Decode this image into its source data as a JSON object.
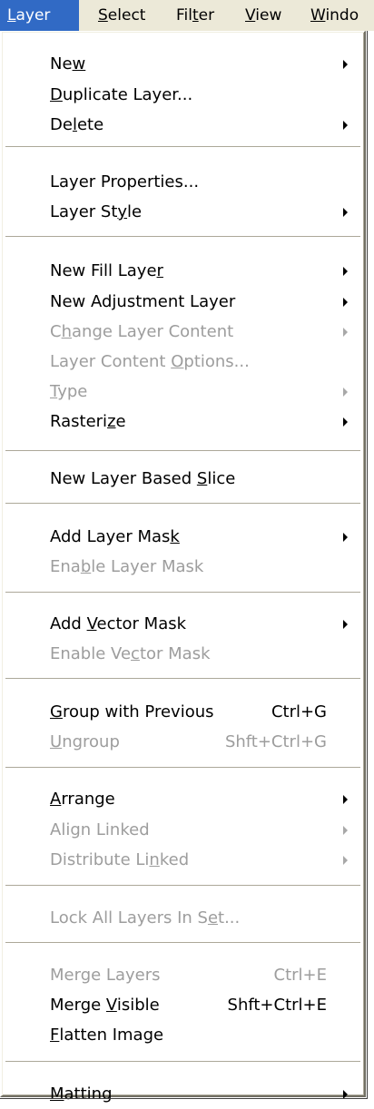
{
  "menubar": {
    "items": [
      {
        "label": "Layer",
        "ul": "L",
        "rest": "ayer"
      },
      {
        "label": "Select",
        "ul": "S",
        "rest": "elect"
      },
      {
        "label": "Filter",
        "pre": "Fil",
        "ul": "t",
        "rest": "er"
      },
      {
        "label": "View",
        "ul": "V",
        "rest": "iew"
      },
      {
        "label": "Window",
        "ul": "W",
        "rest": "indo"
      }
    ]
  },
  "menu": {
    "items": [
      {
        "label": "New",
        "pre": "Ne",
        "ul": "w",
        "rest": "",
        "shortcut": "",
        "submenu": true,
        "disabled": false
      },
      {
        "label": "Duplicate Layer...",
        "pre": "",
        "ul": "D",
        "rest": "uplicate Layer...",
        "shortcut": "",
        "submenu": false,
        "disabled": false
      },
      {
        "label": "Delete",
        "pre": "De",
        "ul": "l",
        "rest": "ete",
        "shortcut": "",
        "submenu": true,
        "disabled": false
      },
      {
        "label": "Layer Properties...",
        "pre": "Layer Properties...",
        "ul": "",
        "rest": "",
        "shortcut": "",
        "submenu": false,
        "disabled": false
      },
      {
        "label": "Layer Style",
        "pre": "Layer St",
        "ul": "y",
        "rest": "le",
        "shortcut": "",
        "submenu": true,
        "disabled": false
      },
      {
        "label": "New Fill Layer",
        "pre": "New Fill Laye",
        "ul": "r",
        "rest": "",
        "shortcut": "",
        "submenu": true,
        "disabled": false
      },
      {
        "label": "New Adjustment Layer",
        "pre": "New Ad",
        "ul": "j",
        "rest": "ustment Layer",
        "shortcut": "",
        "submenu": true,
        "disabled": false
      },
      {
        "label": "Change Layer Content",
        "pre": "C",
        "ul": "h",
        "rest": "ange Layer Content",
        "shortcut": "",
        "submenu": true,
        "disabled": true
      },
      {
        "label": "Layer Content Options...",
        "pre": "Layer Content ",
        "ul": "O",
        "rest": "ptions...",
        "shortcut": "",
        "submenu": false,
        "disabled": true
      },
      {
        "label": "Type",
        "pre": "",
        "ul": "T",
        "rest": "ype",
        "shortcut": "",
        "submenu": true,
        "disabled": true
      },
      {
        "label": "Rasterize",
        "pre": "Rasteri",
        "ul": "z",
        "rest": "e",
        "shortcut": "",
        "submenu": true,
        "disabled": false
      },
      {
        "label": "New Layer Based Slice",
        "pre": "New Layer Based ",
        "ul": "S",
        "rest": "lice",
        "shortcut": "",
        "submenu": false,
        "disabled": false
      },
      {
        "label": "Add Layer Mask",
        "pre": "Add Layer Mas",
        "ul": "k",
        "rest": "",
        "shortcut": "",
        "submenu": true,
        "disabled": false
      },
      {
        "label": "Enable Layer Mask",
        "pre": "Ena",
        "ul": "b",
        "rest": "le Layer Mask",
        "shortcut": "",
        "submenu": false,
        "disabled": true
      },
      {
        "label": "Add Vector Mask",
        "pre": "Add ",
        "ul": "V",
        "rest": "ector Mask",
        "shortcut": "",
        "submenu": true,
        "disabled": false
      },
      {
        "label": "Enable Vector Mask",
        "pre": "Enable Ve",
        "ul": "c",
        "rest": "tor Mask",
        "shortcut": "",
        "submenu": false,
        "disabled": true
      },
      {
        "label": "Group with Previous",
        "pre": "",
        "ul": "G",
        "rest": "roup with Previous",
        "shortcut": "Ctrl+G",
        "submenu": false,
        "disabled": false
      },
      {
        "label": "Ungroup",
        "pre": "",
        "ul": "U",
        "rest": "ngroup",
        "shortcut": "Shft+Ctrl+G",
        "submenu": false,
        "disabled": true
      },
      {
        "label": "Arrange",
        "pre": "",
        "ul": "A",
        "rest": "rrange",
        "shortcut": "",
        "submenu": true,
        "disabled": false
      },
      {
        "label": "Align Linked",
        "pre": "Ali",
        "ul": "g",
        "rest": "n Linked",
        "shortcut": "",
        "submenu": true,
        "disabled": true
      },
      {
        "label": "Distribute Linked",
        "pre": "Distribute Li",
        "ul": "n",
        "rest": "ked",
        "shortcut": "",
        "submenu": true,
        "disabled": true
      },
      {
        "label": "Lock All Layers In Set...",
        "pre": "Lock All Layers In S",
        "ul": "e",
        "rest": "t...",
        "shortcut": "",
        "submenu": false,
        "disabled": true
      },
      {
        "label": "Merge Layers",
        "pre": "Merge Layers",
        "ul": "",
        "rest": "",
        "shortcut": "Ctrl+E",
        "submenu": false,
        "disabled": true
      },
      {
        "label": "Merge Visible",
        "pre": "Merge ",
        "ul": "V",
        "rest": "isible",
        "shortcut": "Shft+Ctrl+E",
        "submenu": false,
        "disabled": false
      },
      {
        "label": "Flatten Image",
        "pre": "",
        "ul": "F",
        "rest": "latten Image",
        "shortcut": "",
        "submenu": false,
        "disabled": false
      },
      {
        "label": "Matting",
        "pre": "",
        "ul": "M",
        "rest": "atting",
        "shortcut": "",
        "submenu": true,
        "disabled": false
      }
    ]
  },
  "colors": {
    "menubar_bg": "#ece9d8",
    "highlight": "#316ac5",
    "disabled_text": "#9d9d9d",
    "separator": "#aca899"
  }
}
